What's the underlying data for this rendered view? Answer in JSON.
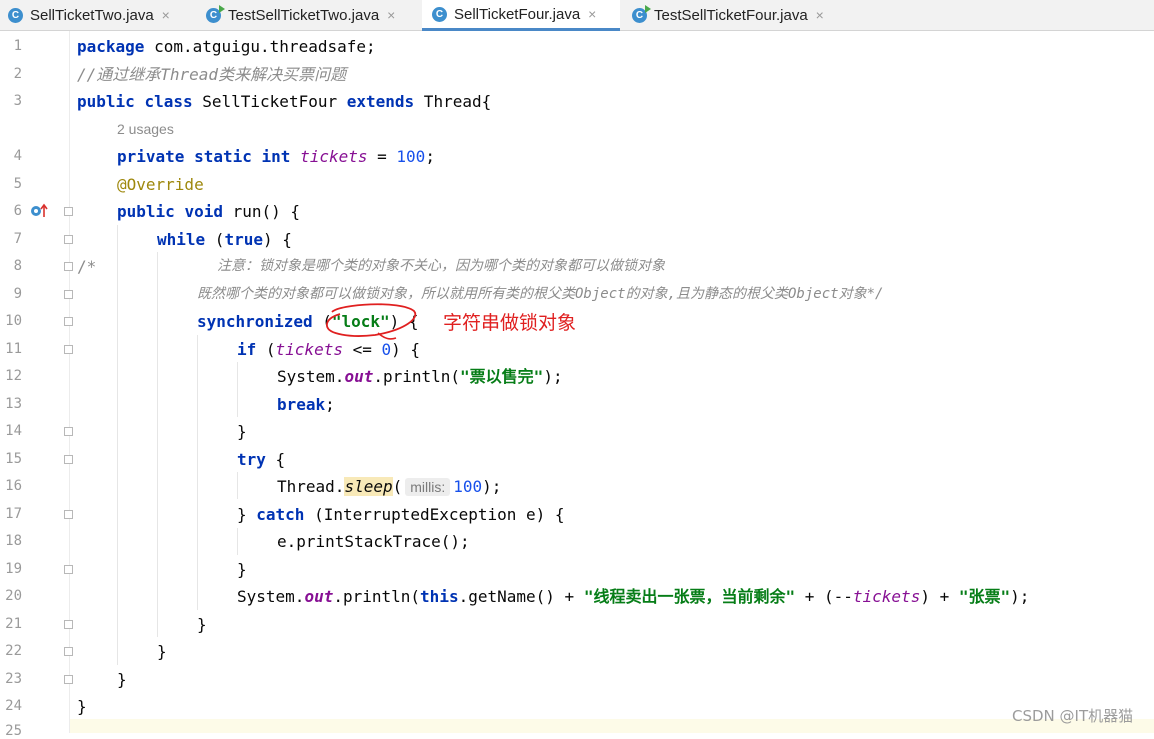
{
  "tabs": [
    {
      "label": "SellTicketTwo.java",
      "icon": "class-icon",
      "runnable": false,
      "active": false
    },
    {
      "label": "TestSellTicketTwo.java",
      "icon": "runnable-class-icon",
      "runnable": true,
      "active": false
    },
    {
      "label": "SellTicketFour.java",
      "icon": "class-icon",
      "runnable": false,
      "active": true
    },
    {
      "label": "TestSellTicketFour.java",
      "icon": "runnable-class-icon",
      "runnable": true,
      "active": false
    }
  ],
  "tab_icon_letter": "C",
  "close_glyph": "×",
  "line_numbers": [
    "1",
    "2",
    "3",
    "4",
    "5",
    "6",
    "7",
    "8",
    "9",
    "10",
    "11",
    "12",
    "13",
    "14",
    "15",
    "16",
    "17",
    "18",
    "19",
    "20",
    "21",
    "22",
    "23",
    "24",
    "25"
  ],
  "code": {
    "l1": {
      "kw": "package",
      "rest": " com.atguigu.threadsafe;"
    },
    "l2": {
      "comment": "//通过继承Thread类来解决买票问题"
    },
    "l3": {
      "kw1": "public",
      "kw2": "class",
      "name": " SellTicketFour ",
      "kw3": "extends",
      "rest": " Thread{"
    },
    "usages": "2 usages",
    "l4": {
      "kw1": "private",
      "kw2": "static",
      "kw3": "int",
      "field": "tickets",
      "op": " = ",
      "num": "100",
      "end": ";"
    },
    "l5": {
      "annotation": "@Override"
    },
    "l6": {
      "kw1": "public",
      "kw2": "void",
      "rest": " run() {"
    },
    "l7": {
      "kw": "while",
      "open": " (",
      "val": "true",
      "close": ") {"
    },
    "l8": {
      "start": "/*",
      "text": "注意：锁对象是哪个类的对象不关心，因为哪个类的对象都可以做锁对象"
    },
    "l9": {
      "text": "既然哪个类的对象都可以做锁对象，所以就用所有类的根父类Object的对象,且为静态的根父类Object对象*/"
    },
    "l10": {
      "kw": "synchronized",
      "open": " (",
      "str": "\"lock\"",
      "close": ") {"
    },
    "l11": {
      "kw": "if",
      "open": " (",
      "field": "tickets",
      "op": " <= ",
      "num": "0",
      "close": ") {"
    },
    "l12": {
      "pre": "System.",
      "stat": "out",
      "mid": ".println(",
      "str": "\"票以售完\"",
      "end": ");"
    },
    "l13": {
      "kw": "break",
      "end": ";"
    },
    "l14": {
      "text": "}"
    },
    "l15": {
      "kw": "try",
      "end": " {"
    },
    "l16": {
      "pre": "Thread.",
      "method": "sleep",
      "open": "(",
      "hint": "millis:",
      "num": "100",
      "end": ");"
    },
    "l17": {
      "pre": "} ",
      "kw": "catch",
      "rest": " (InterruptedException e) {"
    },
    "l18": {
      "text": "e.printStackTrace();"
    },
    "l19": {
      "text": "}"
    },
    "l20": {
      "pre": "System.",
      "stat": "out",
      "mid": ".println(",
      "kw": "this",
      "mid2": ".getName() + ",
      "str1": "\"线程卖出一张票，当前剩余\"",
      "mid3": " + (--",
      "field": "tickets",
      "mid4": ") + ",
      "str2": "\"张票\"",
      "end": ");"
    },
    "l21": {
      "text": "}"
    },
    "l22": {
      "text": "}"
    },
    "l23": {
      "text": "}"
    },
    "l24": {
      "text": "}"
    }
  },
  "annotation_note": "字符串做锁对象",
  "watermark": "CSDN @IT机器猫",
  "colors": {
    "keyword": "#0033b3",
    "string": "#067d17",
    "number": "#1750eb",
    "field": "#871094",
    "annotation": "#9e880d",
    "comment": "#8c8c8c",
    "red_note": "#e02020",
    "tab_active_underline": "#4a88c7"
  }
}
